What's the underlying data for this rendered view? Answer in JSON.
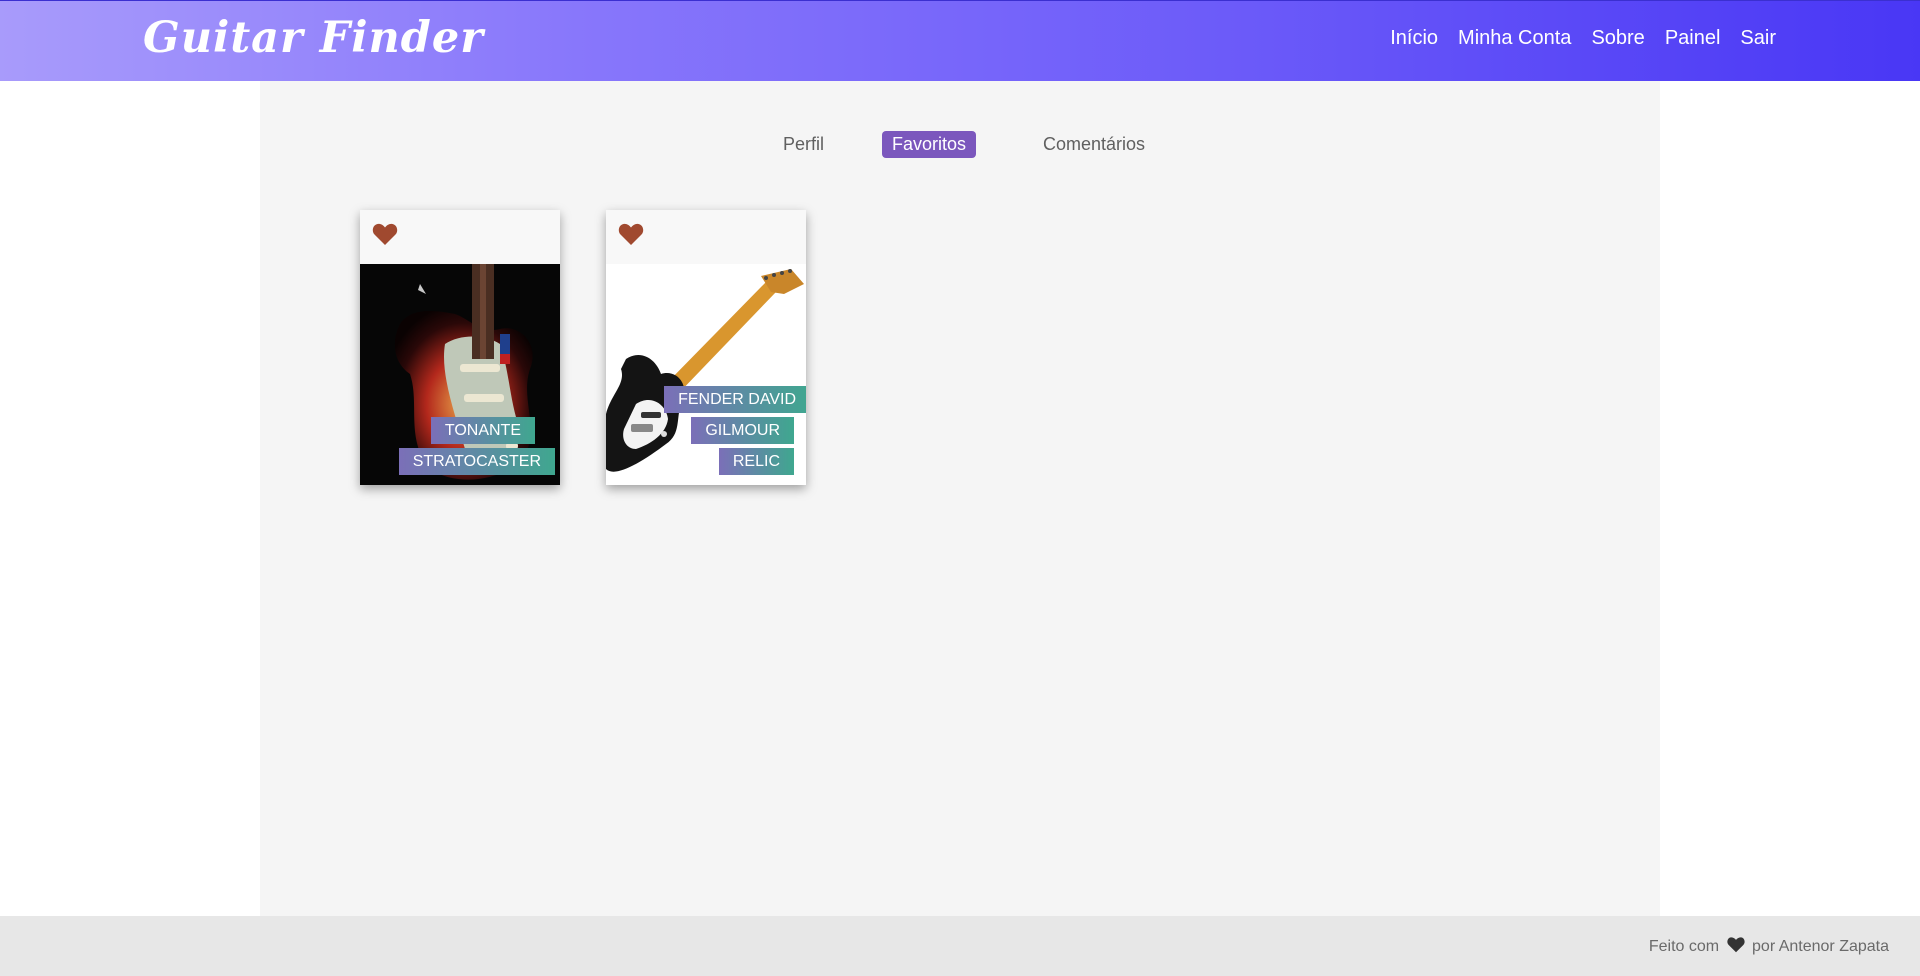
{
  "header": {
    "brand": "Guitar Finder",
    "nav": [
      "Início",
      "Minha Conta",
      "Sobre",
      "Painel",
      "Sair"
    ]
  },
  "tabs": {
    "items": [
      "Perfil",
      "Favoritos",
      "Comentários"
    ],
    "active": "Favoritos"
  },
  "favorites": [
    {
      "tags": [
        "TONANTE",
        "STRATOCASTER"
      ]
    },
    {
      "tags": [
        "FENDER DAVID",
        "GILMOUR",
        "RELIC"
      ]
    }
  ],
  "footer": {
    "prefix": "Feito com",
    "suffix": "por Antenor Zapata"
  },
  "colors": {
    "header_gradient_start": "#a89bfb",
    "header_gradient_end": "#4937f5",
    "active_tab": "#7b57bd",
    "heart": "#a0492f"
  }
}
